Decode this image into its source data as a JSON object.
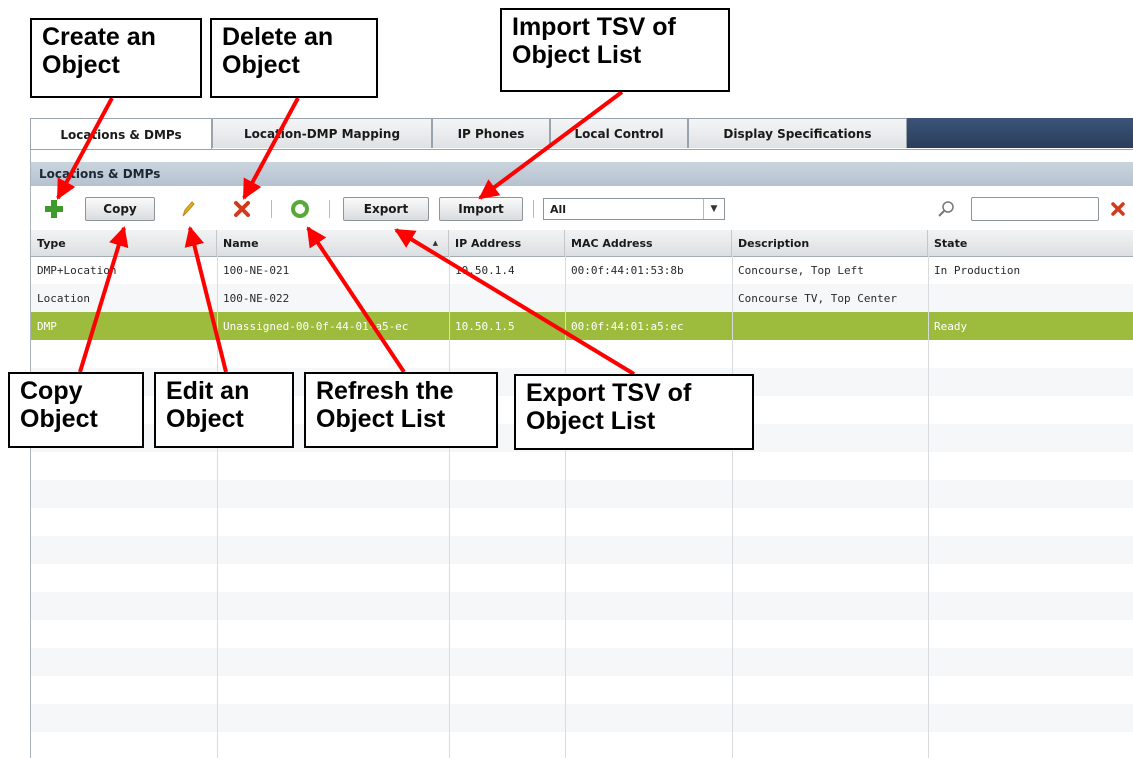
{
  "tabs": [
    {
      "label": "Locations & DMPs",
      "active": true
    },
    {
      "label": "Location-DMP Mapping",
      "active": false
    },
    {
      "label": "IP Phones",
      "active": false
    },
    {
      "label": "Local Control",
      "active": false
    },
    {
      "label": "Display Specifications",
      "active": false
    }
  ],
  "section_title": "Locations & DMPs",
  "toolbar": {
    "add_icon": "plus-icon",
    "copy_label": "Copy",
    "edit_icon": "pencil-icon",
    "delete_icon": "delete-x-icon",
    "refresh_icon": "refresh-icon",
    "export_label": "Export",
    "import_label": "Import",
    "filter_value": "All",
    "search_icon": "magnifier-icon",
    "clear_icon": "clear-x-icon",
    "search_value": ""
  },
  "table": {
    "columns": [
      "Type",
      "Name",
      "IP Address",
      "MAC Address",
      "Description",
      "State"
    ],
    "rows": [
      [
        "DMP+Location",
        "100-NE-021",
        "10.50.1.4",
        "00:0f:44:01:53:8b",
        "Concourse, Top Left",
        "In Production"
      ],
      [
        "Location",
        "100-NE-022",
        "",
        "",
        "Concourse TV, Top Center",
        ""
      ],
      [
        "DMP",
        "Unassigned-00-0f-44-01-a5-ec",
        "10.50.1.5",
        "00:0f:44:01:a5:ec",
        "",
        "Ready"
      ]
    ],
    "selected_row": 3
  },
  "annotations": {
    "create": [
      "Create an",
      "Object"
    ],
    "delete": [
      "Delete an",
      "Object"
    ],
    "import": [
      "Import TSV of",
      "Object List"
    ],
    "copy": [
      "Copy",
      "Object"
    ],
    "edit": [
      "Edit an",
      "Object"
    ],
    "refresh": [
      "Refresh the",
      "Object List"
    ],
    "export": [
      "Export TSV of",
      "Object List"
    ]
  },
  "colors": {
    "selected_row": "#9dbb3c",
    "arrow": "#ff0000",
    "add_icon": "#3f9a2c",
    "delete_icon": "#d23a1c",
    "pencil_icon": "#e3b320",
    "refresh_icon": "#5aa83a"
  }
}
